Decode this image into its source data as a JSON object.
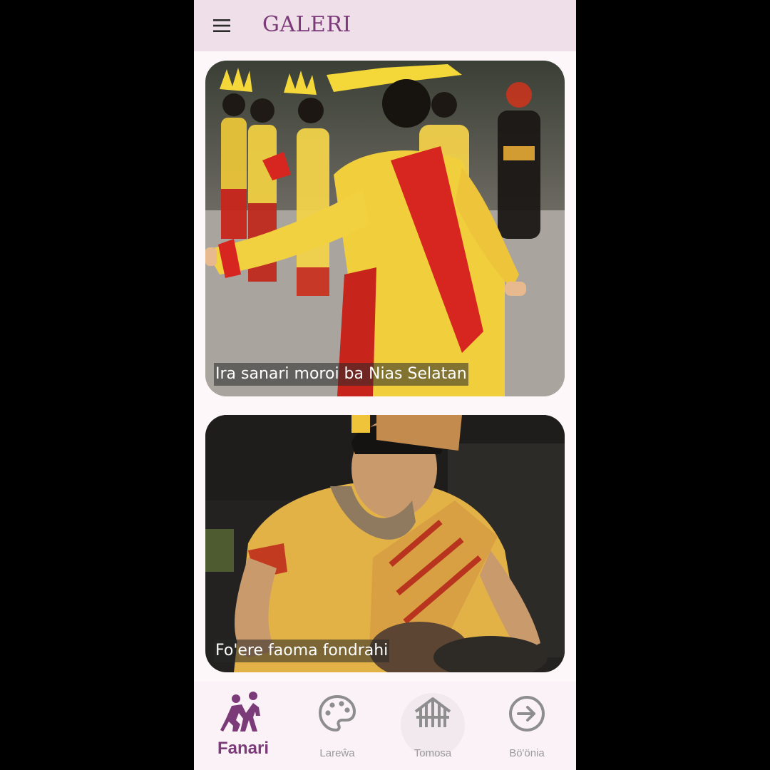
{
  "app": {
    "title": "GALERI",
    "accent_color": "#7b3b78",
    "appbar_color": "#eedfe8",
    "menu_icon": "hamburger-menu-icon"
  },
  "gallery": [
    {
      "caption": "Ira sanari moroi ba Nias Selatan",
      "image": "dancers-yellow-red-costume-photo"
    },
    {
      "caption": "Fo'ere faoma fondrahi",
      "image": "girl-playing-drum-photo"
    }
  ],
  "bottom_nav": {
    "items": [
      {
        "label": "Fanari",
        "icon": "dancers-icon",
        "active": true
      },
      {
        "label": "Lareŵa",
        "icon": "palette-icon",
        "active": false
      },
      {
        "label": "Tomosa",
        "icon": "traditional-house-icon",
        "active": false
      },
      {
        "label": "Bö'önia",
        "icon": "arrow-right-circle-icon",
        "active": false
      }
    ]
  }
}
